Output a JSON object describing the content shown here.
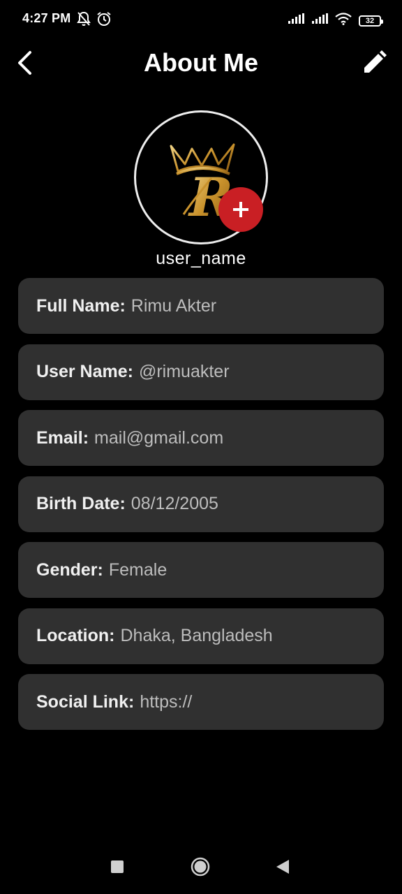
{
  "status_bar": {
    "time": "4:27 PM",
    "battery": "32",
    "icons": [
      "notifications-off-icon",
      "alarm-icon",
      "signal-icon",
      "signal-icon",
      "wifi-icon",
      "battery-icon"
    ]
  },
  "app_bar": {
    "title": "About Me",
    "back_icon": "chevron-left-icon",
    "edit_icon": "pencil-icon"
  },
  "profile": {
    "username": "user_name",
    "avatar_monogram": "R",
    "add_icon": "plus-icon"
  },
  "info": [
    {
      "label": "Full Name:",
      "value": "Rimu Akter"
    },
    {
      "label": "User Name:",
      "value": "@rimuakter"
    },
    {
      "label": "Email:",
      "value": "mail@gmail.com"
    },
    {
      "label": "Birth Date:",
      "value": "08/12/2005"
    },
    {
      "label": "Gender:",
      "value": "Female"
    },
    {
      "label": "Location:",
      "value": "Dhaka, Bangladesh"
    },
    {
      "label": "Social Link:",
      "value": "https://"
    }
  ],
  "colors": {
    "background": "#000000",
    "card": "#303030",
    "accent_red": "#c91f24",
    "gold": "#d4a43a"
  },
  "nav_bar": {
    "icons": [
      "recents-square-icon",
      "home-circle-icon",
      "back-triangle-icon"
    ]
  }
}
